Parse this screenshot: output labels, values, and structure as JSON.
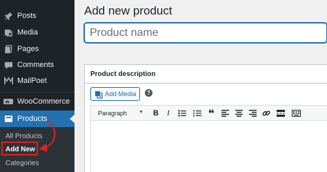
{
  "sidebar": {
    "items": [
      {
        "label": "Posts",
        "icon": "pin-icon"
      },
      {
        "label": "Media",
        "icon": "media-icon"
      },
      {
        "label": "Pages",
        "icon": "pages-icon"
      },
      {
        "label": "Comments",
        "icon": "comments-icon"
      },
      {
        "label": "MailPoet",
        "icon": "mailpoet-icon"
      },
      {
        "label": "WooCommerce",
        "icon": "woocommerce-icon"
      },
      {
        "label": "Products",
        "icon": "products-icon"
      }
    ],
    "submenu": [
      {
        "label": "All Products"
      },
      {
        "label": "Add New"
      },
      {
        "label": "Categories"
      }
    ]
  },
  "main": {
    "title": "Add new product",
    "product_name_placeholder": "Product name",
    "description": {
      "title": "Product description",
      "add_media_label": "Add Media",
      "help_label": "?",
      "format_select_value": "Paragraph",
      "format_select_caret": "▼",
      "toolbar": {
        "bold": "B",
        "italic": "I",
        "blockquote": "❝"
      }
    }
  },
  "colors": {
    "sidebar_bg": "#1d2327",
    "active_bg": "#2271b1",
    "highlight": "#e02020",
    "accent": "#2271b1"
  }
}
